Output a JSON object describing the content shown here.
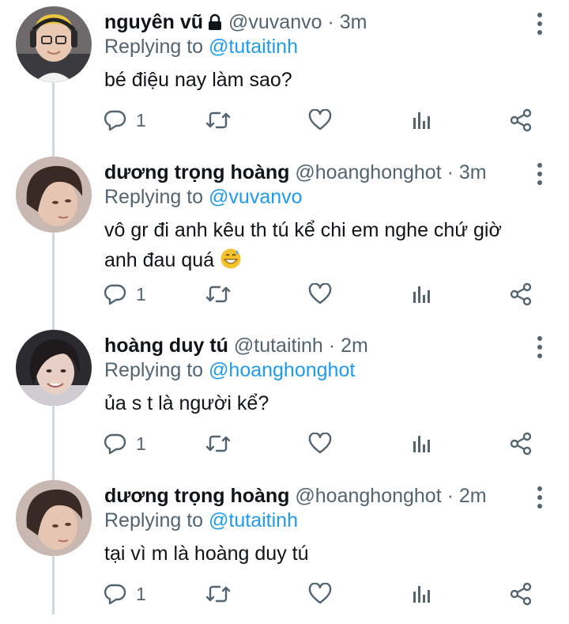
{
  "tweets": [
    {
      "name": "nguyên vũ",
      "protected": true,
      "handle": "@vuvanvo",
      "dot": "·",
      "time": "3m",
      "replying_prefix": "Replying to",
      "replying_to": "@tutaitinh",
      "text": "bé điệu nay làm sao?",
      "reply_count": "1"
    },
    {
      "name": "dương trọng hoàng",
      "protected": false,
      "handle": "@hoanghonghot",
      "dot": "·",
      "time": "3m",
      "replying_prefix": "Replying to",
      "replying_to": "@vuvanvo",
      "text": "vô gr đi anh kêu th tú kể chi em nghe chứ giờ anh đau quá",
      "emoji": "grinning-sweat-emoji",
      "reply_count": "1"
    },
    {
      "name": "hoàng duy tú",
      "protected": false,
      "handle": "@tutaitinh",
      "dot": "·",
      "time": "2m",
      "replying_prefix": "Replying to",
      "replying_to": "@hoanghonghot",
      "text": "ủa s t là người kể?",
      "reply_count": "1"
    },
    {
      "name": "dương trọng hoàng",
      "protected": false,
      "handle": "@hoanghonghot",
      "dot": "·",
      "time": "2m",
      "replying_prefix": "Replying to",
      "replying_to": "@tutaitinh",
      "text": "tại vì m là hoàng duy tú",
      "reply_count": "1"
    }
  ],
  "icons": {
    "reply": "reply-icon",
    "retweet": "retweet-icon",
    "like": "like-icon",
    "views": "analytics-icon",
    "share": "share-icon",
    "more": "more-vertical-icon",
    "lock": "lock-icon"
  },
  "colors": {
    "text": "#0f1419",
    "secondary": "#536471",
    "accent": "#1d9bf0",
    "thread_line": "#cfd9de"
  }
}
